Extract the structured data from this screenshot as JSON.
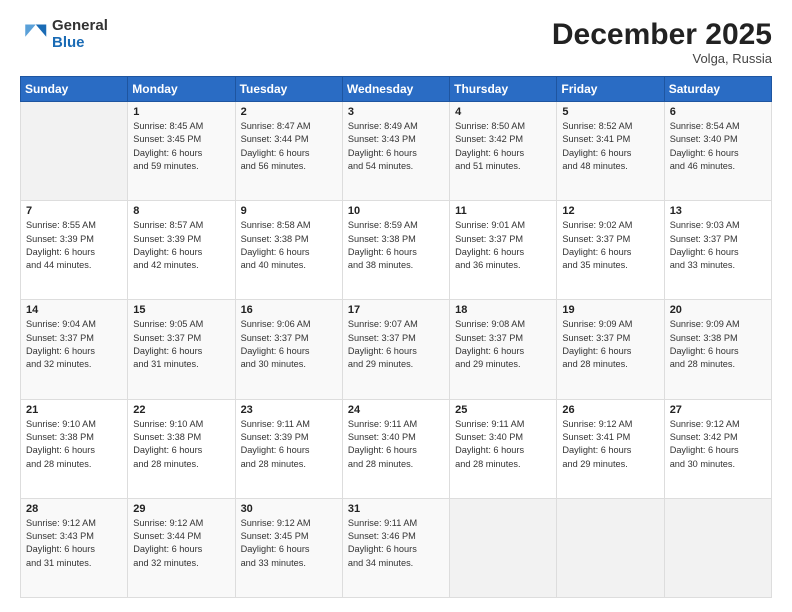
{
  "logo": {
    "general": "General",
    "blue": "Blue"
  },
  "header": {
    "title": "December 2025",
    "subtitle": "Volga, Russia"
  },
  "days_of_week": [
    "Sunday",
    "Monday",
    "Tuesday",
    "Wednesday",
    "Thursday",
    "Friday",
    "Saturday"
  ],
  "weeks": [
    [
      {
        "day": "",
        "info": ""
      },
      {
        "day": "1",
        "info": "Sunrise: 8:45 AM\nSunset: 3:45 PM\nDaylight: 6 hours\nand 59 minutes."
      },
      {
        "day": "2",
        "info": "Sunrise: 8:47 AM\nSunset: 3:44 PM\nDaylight: 6 hours\nand 56 minutes."
      },
      {
        "day": "3",
        "info": "Sunrise: 8:49 AM\nSunset: 3:43 PM\nDaylight: 6 hours\nand 54 minutes."
      },
      {
        "day": "4",
        "info": "Sunrise: 8:50 AM\nSunset: 3:42 PM\nDaylight: 6 hours\nand 51 minutes."
      },
      {
        "day": "5",
        "info": "Sunrise: 8:52 AM\nSunset: 3:41 PM\nDaylight: 6 hours\nand 48 minutes."
      },
      {
        "day": "6",
        "info": "Sunrise: 8:54 AM\nSunset: 3:40 PM\nDaylight: 6 hours\nand 46 minutes."
      }
    ],
    [
      {
        "day": "7",
        "info": "Sunrise: 8:55 AM\nSunset: 3:39 PM\nDaylight: 6 hours\nand 44 minutes."
      },
      {
        "day": "8",
        "info": "Sunrise: 8:57 AM\nSunset: 3:39 PM\nDaylight: 6 hours\nand 42 minutes."
      },
      {
        "day": "9",
        "info": "Sunrise: 8:58 AM\nSunset: 3:38 PM\nDaylight: 6 hours\nand 40 minutes."
      },
      {
        "day": "10",
        "info": "Sunrise: 8:59 AM\nSunset: 3:38 PM\nDaylight: 6 hours\nand 38 minutes."
      },
      {
        "day": "11",
        "info": "Sunrise: 9:01 AM\nSunset: 3:37 PM\nDaylight: 6 hours\nand 36 minutes."
      },
      {
        "day": "12",
        "info": "Sunrise: 9:02 AM\nSunset: 3:37 PM\nDaylight: 6 hours\nand 35 minutes."
      },
      {
        "day": "13",
        "info": "Sunrise: 9:03 AM\nSunset: 3:37 PM\nDaylight: 6 hours\nand 33 minutes."
      }
    ],
    [
      {
        "day": "14",
        "info": "Sunrise: 9:04 AM\nSunset: 3:37 PM\nDaylight: 6 hours\nand 32 minutes."
      },
      {
        "day": "15",
        "info": "Sunrise: 9:05 AM\nSunset: 3:37 PM\nDaylight: 6 hours\nand 31 minutes."
      },
      {
        "day": "16",
        "info": "Sunrise: 9:06 AM\nSunset: 3:37 PM\nDaylight: 6 hours\nand 30 minutes."
      },
      {
        "day": "17",
        "info": "Sunrise: 9:07 AM\nSunset: 3:37 PM\nDaylight: 6 hours\nand 29 minutes."
      },
      {
        "day": "18",
        "info": "Sunrise: 9:08 AM\nSunset: 3:37 PM\nDaylight: 6 hours\nand 29 minutes."
      },
      {
        "day": "19",
        "info": "Sunrise: 9:09 AM\nSunset: 3:37 PM\nDaylight: 6 hours\nand 28 minutes."
      },
      {
        "day": "20",
        "info": "Sunrise: 9:09 AM\nSunset: 3:38 PM\nDaylight: 6 hours\nand 28 minutes."
      }
    ],
    [
      {
        "day": "21",
        "info": "Sunrise: 9:10 AM\nSunset: 3:38 PM\nDaylight: 6 hours\nand 28 minutes."
      },
      {
        "day": "22",
        "info": "Sunrise: 9:10 AM\nSunset: 3:38 PM\nDaylight: 6 hours\nand 28 minutes."
      },
      {
        "day": "23",
        "info": "Sunrise: 9:11 AM\nSunset: 3:39 PM\nDaylight: 6 hours\nand 28 minutes."
      },
      {
        "day": "24",
        "info": "Sunrise: 9:11 AM\nSunset: 3:40 PM\nDaylight: 6 hours\nand 28 minutes."
      },
      {
        "day": "25",
        "info": "Sunrise: 9:11 AM\nSunset: 3:40 PM\nDaylight: 6 hours\nand 28 minutes."
      },
      {
        "day": "26",
        "info": "Sunrise: 9:12 AM\nSunset: 3:41 PM\nDaylight: 6 hours\nand 29 minutes."
      },
      {
        "day": "27",
        "info": "Sunrise: 9:12 AM\nSunset: 3:42 PM\nDaylight: 6 hours\nand 30 minutes."
      }
    ],
    [
      {
        "day": "28",
        "info": "Sunrise: 9:12 AM\nSunset: 3:43 PM\nDaylight: 6 hours\nand 31 minutes."
      },
      {
        "day": "29",
        "info": "Sunrise: 9:12 AM\nSunset: 3:44 PM\nDaylight: 6 hours\nand 32 minutes."
      },
      {
        "day": "30",
        "info": "Sunrise: 9:12 AM\nSunset: 3:45 PM\nDaylight: 6 hours\nand 33 minutes."
      },
      {
        "day": "31",
        "info": "Sunrise: 9:11 AM\nSunset: 3:46 PM\nDaylight: 6 hours\nand 34 minutes."
      },
      {
        "day": "",
        "info": ""
      },
      {
        "day": "",
        "info": ""
      },
      {
        "day": "",
        "info": ""
      }
    ]
  ]
}
